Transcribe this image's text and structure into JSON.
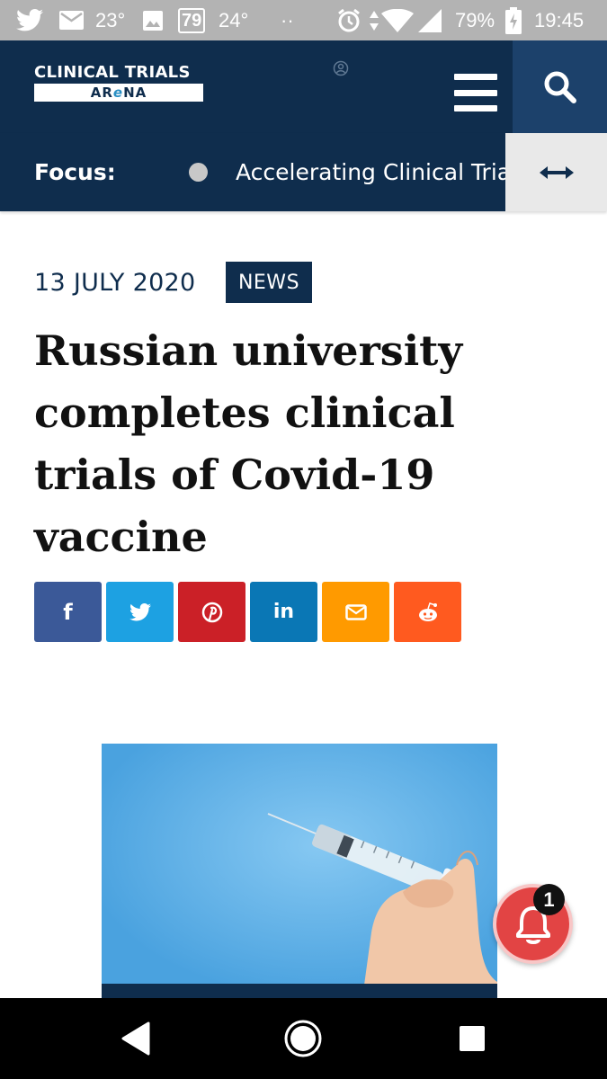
{
  "status_bar": {
    "temp1": "23°",
    "badge_number": "79",
    "temp2": "24°",
    "dots": "··",
    "battery": "79%",
    "time": "19:45",
    "icons": [
      "twitter-icon",
      "mail-icon",
      "image-icon",
      "alarm-icon",
      "data-arrows-icon",
      "wifi-icon",
      "signal-icon",
      "battery-icon"
    ]
  },
  "header": {
    "logo_top": "CLINICAL TRIALS",
    "logo_bottom_pre": "AR",
    "logo_bottom_e": "e",
    "logo_bottom_post": "NA",
    "menu_icon": "hamburger-icon",
    "search_icon": "search-icon"
  },
  "focus": {
    "label": "Focus:",
    "text": "Accelerating Clinical Trials",
    "toggle_icon": "double-arrow-icon"
  },
  "article": {
    "date": "13 JULY 2020",
    "category": "NEWS",
    "title": "Russian university completes clinical trials of Covid-19 vaccine"
  },
  "share": [
    {
      "network": "facebook",
      "glyph": "f",
      "color": "#3b5998"
    },
    {
      "network": "twitter",
      "glyph": "",
      "color": "#1da1e2"
    },
    {
      "network": "pinterest",
      "glyph": "",
      "color": "#cb2027"
    },
    {
      "network": "linkedin",
      "glyph": "in",
      "color": "#0a77b5"
    },
    {
      "network": "email",
      "glyph": "",
      "color": "#ff9a00"
    },
    {
      "network": "reddit",
      "glyph": "",
      "color": "#ff5a1f"
    }
  ],
  "notification": {
    "count": "1"
  },
  "colors": {
    "navy": "#0f2d4d",
    "search_bg": "#1c416b",
    "bell": "#e24444"
  }
}
